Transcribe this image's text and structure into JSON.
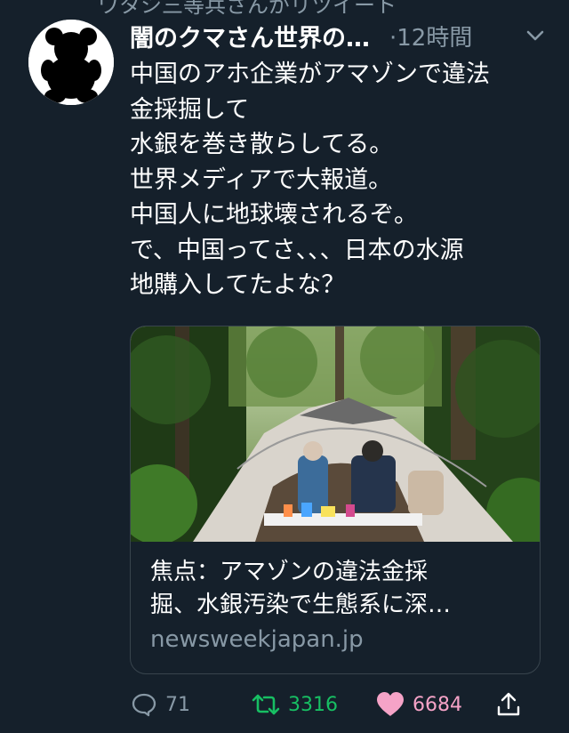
{
  "context": {
    "text": "ワタシ三等兵さんがリツイート"
  },
  "tweet": {
    "display_name": "闇のクマさん世界の…",
    "timestamp": "·12時間",
    "text_lines": [
      "中国のアホ企業がアマゾンで違法",
      "金採掘して",
      "水銀を巻き散らしてる。",
      "世界メディアで大報道。",
      "中国人に地球壊されるぞ。",
      "で、中国ってさ、、、日本の水源",
      "地購入してたよな？"
    ]
  },
  "card": {
    "title_lines": [
      "焦点：アマゾンの違法金採",
      "掘、水銀汚染で生態系に深…"
    ],
    "domain": "newsweekjapan.jp"
  },
  "actions": {
    "reply_count": "71",
    "retweet_count": "3316",
    "like_count": "6684"
  },
  "icons": {
    "avatar": "bear-silhouette-icon",
    "more": "chevron-down-icon",
    "reply": "reply-icon",
    "retweet": "retweet-icon",
    "like": "heart-icon",
    "share": "share-icon"
  },
  "colors": {
    "background": "#15202b",
    "secondary_text": "#8899a6",
    "retweet_green": "#17bf63",
    "like_pink": "#e0245e"
  }
}
